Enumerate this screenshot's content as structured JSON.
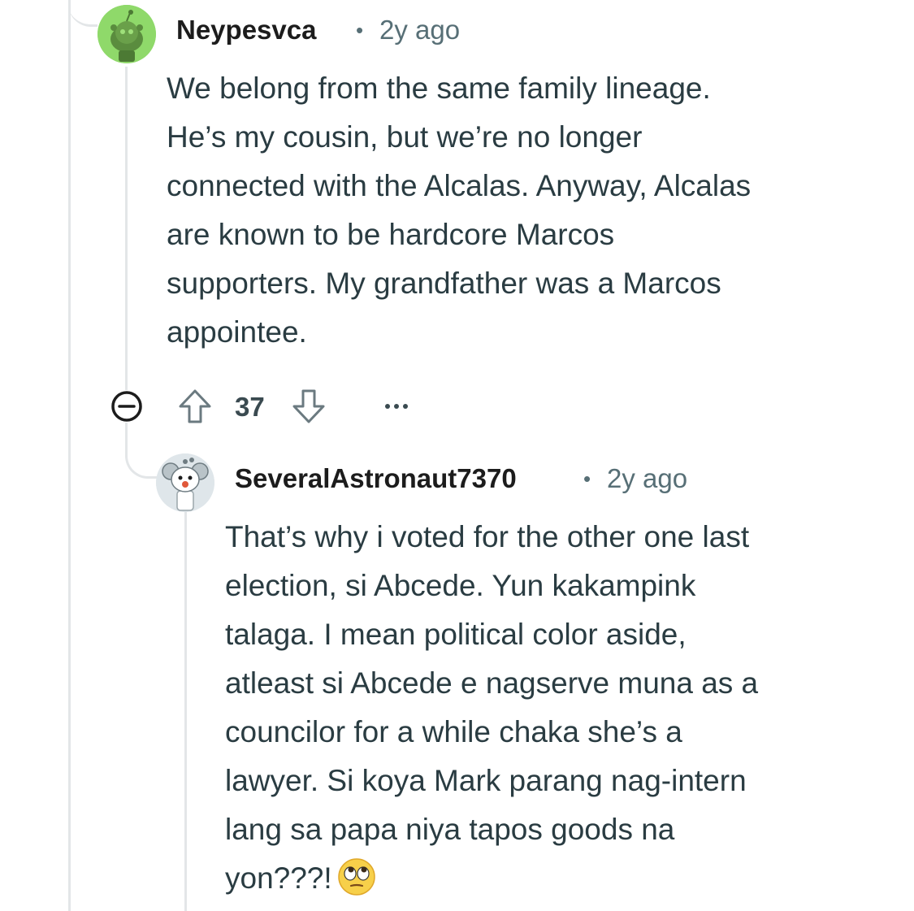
{
  "comment1": {
    "username": "Neypesvca",
    "separator": "•",
    "time": "2y ago",
    "body_lines": [
      "We belong from the same family lineage.",
      "He’s my cousin, but we’re no longer",
      "connected with the Alcalas. Anyway, Alcalas",
      "are known to be hardcore Marcos",
      "supporters. My grandfather was a Marcos",
      "appointee."
    ],
    "votes": "37",
    "avatar_color": "#8fd96a",
    "icons": [
      "collapse-icon",
      "upvote-icon",
      "downvote-icon",
      "more-options-icon"
    ]
  },
  "comment2": {
    "username": "SeveralAstronaut7370",
    "separator": "•",
    "time": "2y ago",
    "body_lines": [
      "That’s why i voted for the other one last",
      "election, si Abcede. Yun kakampink",
      "talaga. I mean political color aside,",
      "atleast si Abcede e nagserve muna as a",
      "councilor for a while chaka she’s a",
      "lawyer. Si koya Mark parang nag-intern",
      "lang sa papa niya tapos goods na",
      "yon???!"
    ],
    "emoji": "eye-roll-emoji"
  },
  "colors": {
    "text": "#2a3c42",
    "meta": "#576f76",
    "thread_line": "#e3e6e8"
  }
}
